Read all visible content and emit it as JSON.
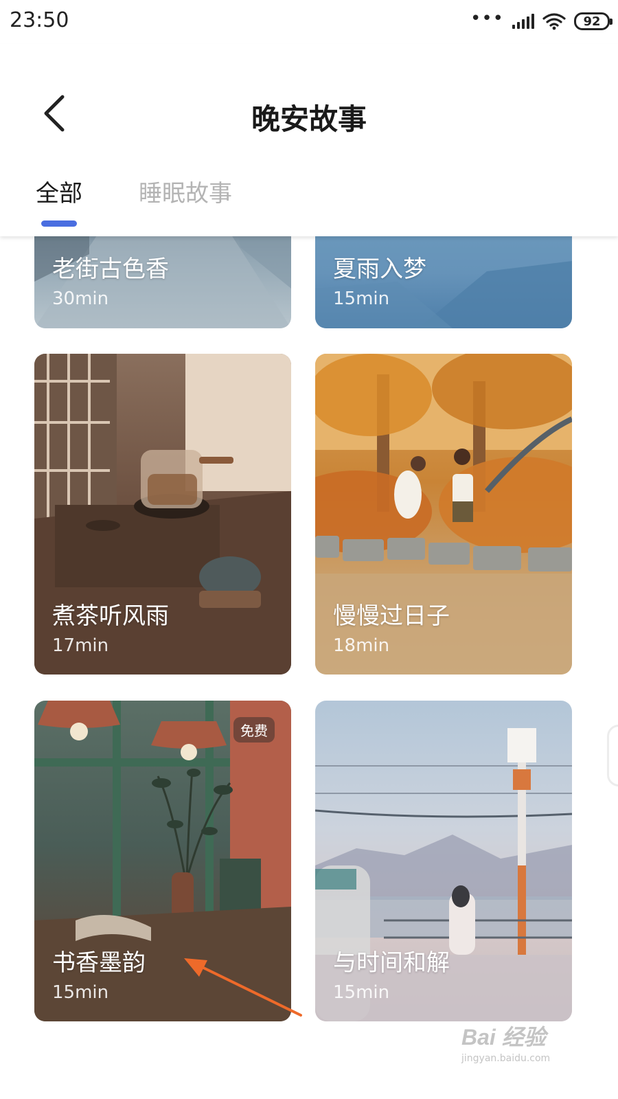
{
  "status_bar": {
    "time": "23:50",
    "dots": "•••",
    "battery": "92",
    "icons": [
      "signal-icon",
      "wifi-icon",
      "battery-icon"
    ]
  },
  "header": {
    "title": "晚安故事",
    "back_icon": "chevron-left-icon",
    "tabs": [
      {
        "label": "全部",
        "active": true
      },
      {
        "label": "睡眠故事",
        "active": false
      }
    ]
  },
  "stories": [
    {
      "title": "老街古色香",
      "duration": "30min"
    },
    {
      "title": "夏雨入梦",
      "duration": "15min"
    },
    {
      "title": "煮茶听风雨",
      "duration": "17min"
    },
    {
      "title": "慢慢过日子",
      "duration": "18min"
    },
    {
      "title": "书香墨韵",
      "duration": "15min",
      "badge": "免费"
    },
    {
      "title": "与时间和解",
      "duration": "15min"
    }
  ],
  "watermark": {
    "brand": "Bai 经验",
    "url": "jingyan.baidu.com"
  },
  "colors": {
    "accent": "#4a6ee0",
    "annotation_arrow": "#ee6a2a",
    "tab_inactive": "#b4b4b4"
  }
}
